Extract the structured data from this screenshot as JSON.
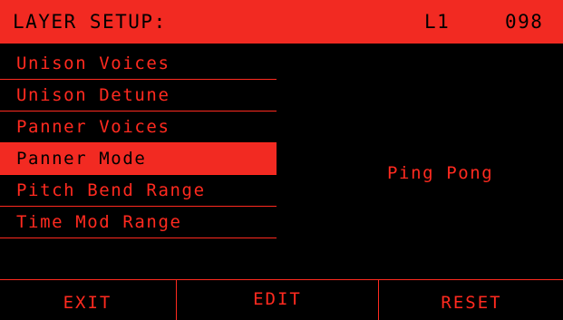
{
  "header": {
    "title": "LAYER SETUP:",
    "layer": "L1",
    "preset_number": "098"
  },
  "menu": {
    "items": [
      {
        "label": "Unison Voices",
        "selected": false
      },
      {
        "label": "Unison Detune",
        "selected": false
      },
      {
        "label": "Panner Voices",
        "selected": false
      },
      {
        "label": "Panner Mode",
        "selected": true
      },
      {
        "label": "Pitch Bend Range",
        "selected": false
      },
      {
        "label": "Time Mod Range",
        "selected": false
      }
    ]
  },
  "value_display": "Ping Pong",
  "softkeys": {
    "exit": "EXIT",
    "edit": "EDIT",
    "reset": "RESET"
  },
  "colors": {
    "accent": "#f22a22",
    "text": "#ff2a1f",
    "background": "#000000"
  }
}
